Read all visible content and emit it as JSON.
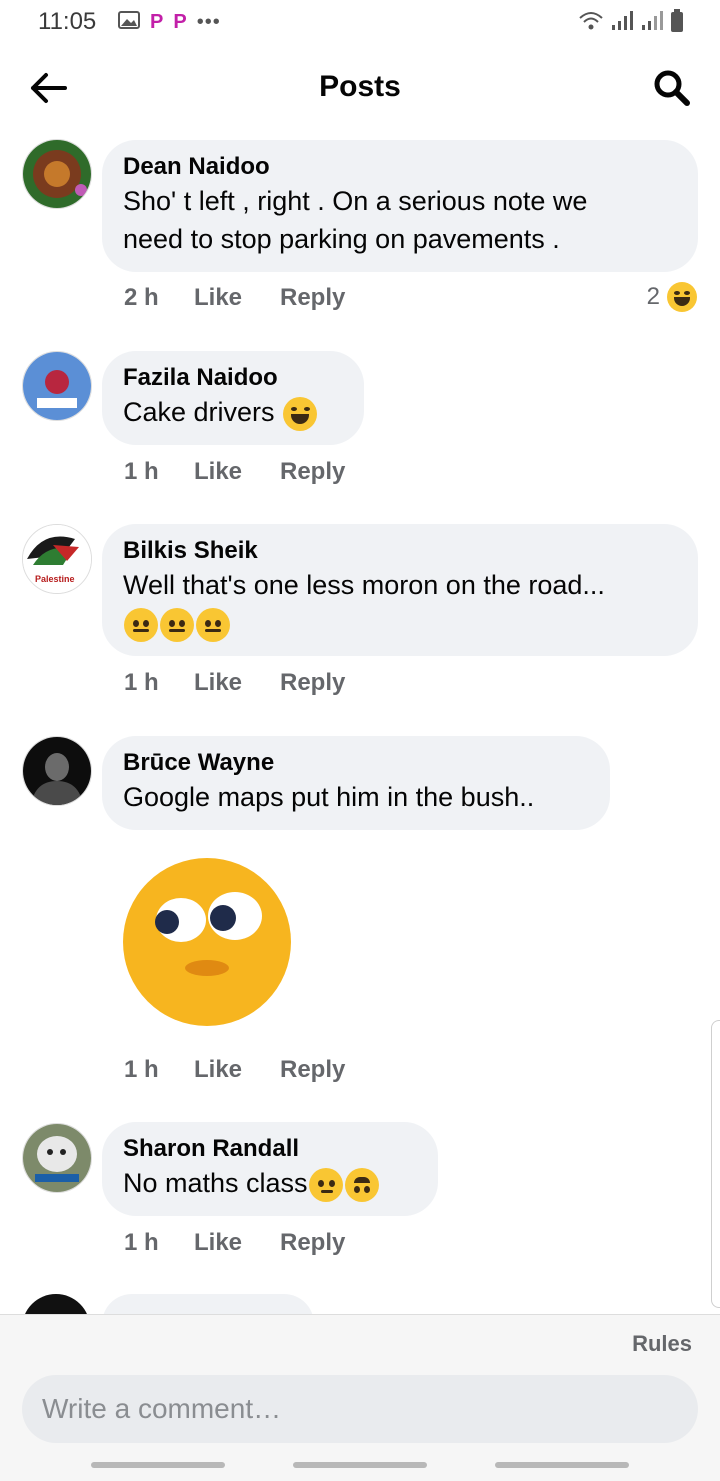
{
  "status_bar": {
    "time": "11:05",
    "left_icons": [
      "image-icon",
      "p-icon",
      "p-icon",
      "more-dots-icon"
    ],
    "right_icons": [
      "wifi-icon",
      "signal-icon",
      "signal-icon",
      "battery-icon"
    ]
  },
  "header": {
    "title": "Posts",
    "back_icon": "arrow-left-icon",
    "search_icon": "search-icon"
  },
  "comments": [
    {
      "author": "Dean Naidoo",
      "text_lines": [
        "Sho' t  left ,  right . On a serious note we",
        "need to stop parking on pavements ."
      ],
      "time": "2 h",
      "like": "Like",
      "reply": "Reply",
      "reaction_count": "2",
      "reaction_icon": "laughing-emoji"
    },
    {
      "author": "Fazila Naidoo",
      "text": "Cake drivers",
      "emoji": "tears-of-joy-emoji",
      "time": "1 h",
      "like": "Like",
      "reply": "Reply"
    },
    {
      "author": "Bilkis Sheik",
      "text": "Well that's one less moron on the road...",
      "emojis": [
        "neutral-face-emoji",
        "neutral-face-emoji",
        "neutral-face-emoji"
      ],
      "avatar_text": "Palestine",
      "time": "1 h",
      "like": "Like",
      "reply": "Reply"
    },
    {
      "author": "Brūce Wayne",
      "text": "Google maps put him in the bush..",
      "sticker": "eye-roll-emoji-sticker",
      "time": "1 h",
      "like": "Like",
      "reply": "Reply"
    },
    {
      "author": "Sharon Randall",
      "text": "No maths class",
      "emojis": [
        "thinking-face-emoji",
        "upside-down-face-emoji"
      ],
      "time": "1 h",
      "like": "Like",
      "reply": "Reply"
    }
  ],
  "composer": {
    "rules": "Rules",
    "placeholder": "Write a comment…"
  },
  "colors": {
    "bubble_bg": "#f0f2f5",
    "meta_text": "#65676b",
    "emoji_yellow": "#f9c633"
  }
}
